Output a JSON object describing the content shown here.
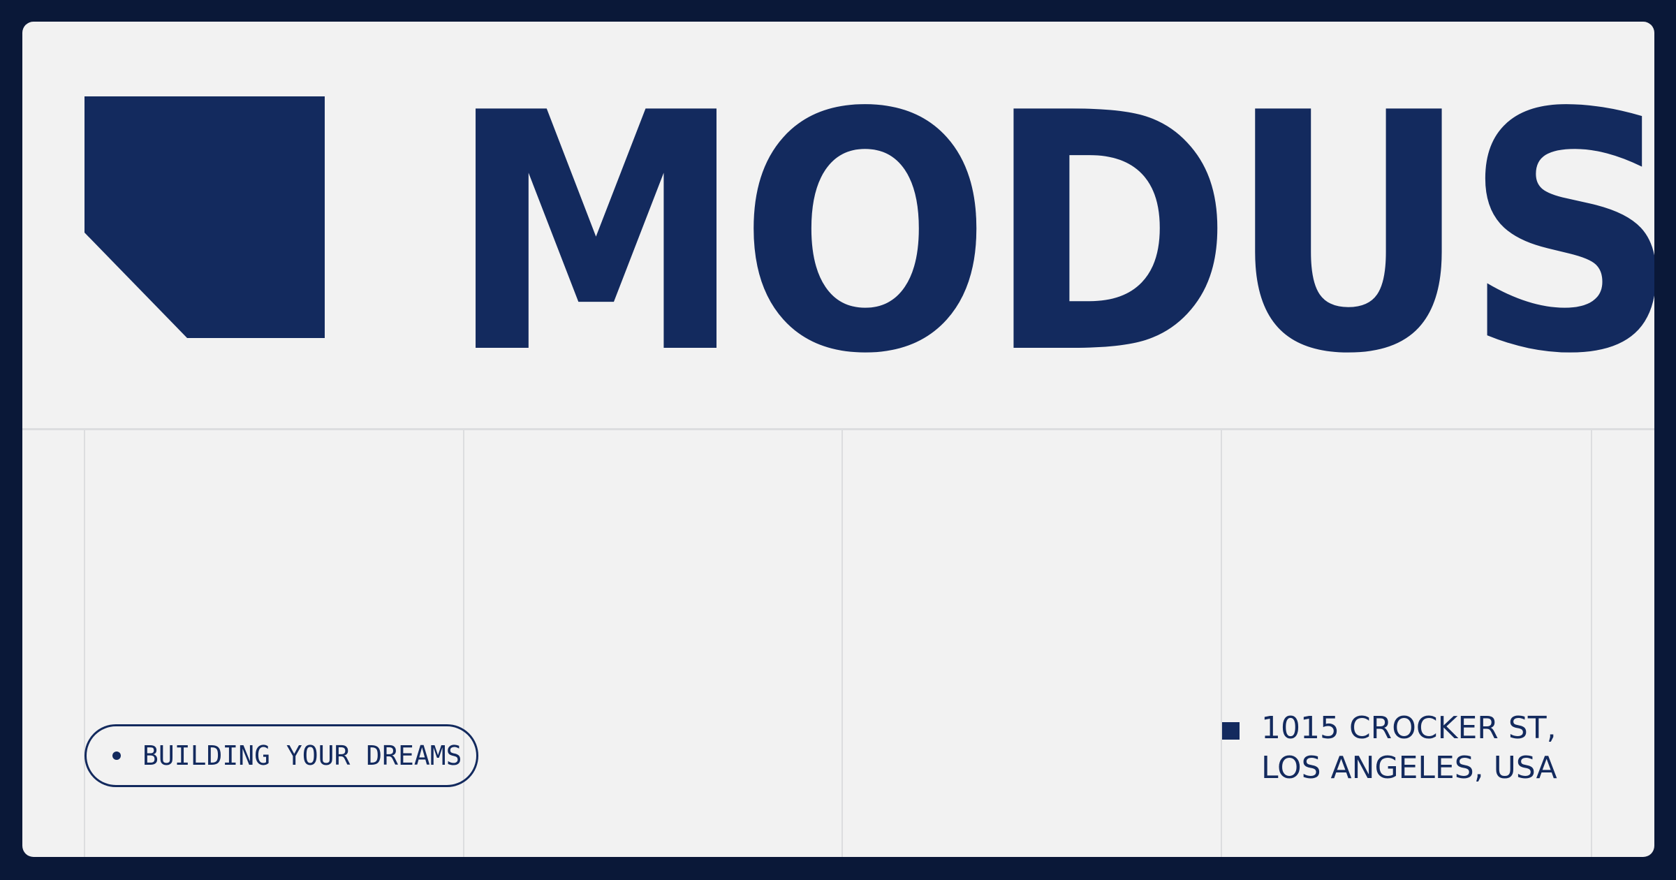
{
  "brand": {
    "name": "MODUS",
    "color": "#132a5e",
    "background": "#f2f2f2",
    "frame_color": "#0a1838"
  },
  "logo": {
    "icon": "chamfered-square-logo-icon"
  },
  "tagline": {
    "label": "BUILDING YOUR DREAMS",
    "bullet_icon": "dot-icon"
  },
  "address": {
    "marker_icon": "square-bullet-icon",
    "line1": "1015 CROCKER ST,",
    "line2": "LOS ANGELES, USA"
  }
}
